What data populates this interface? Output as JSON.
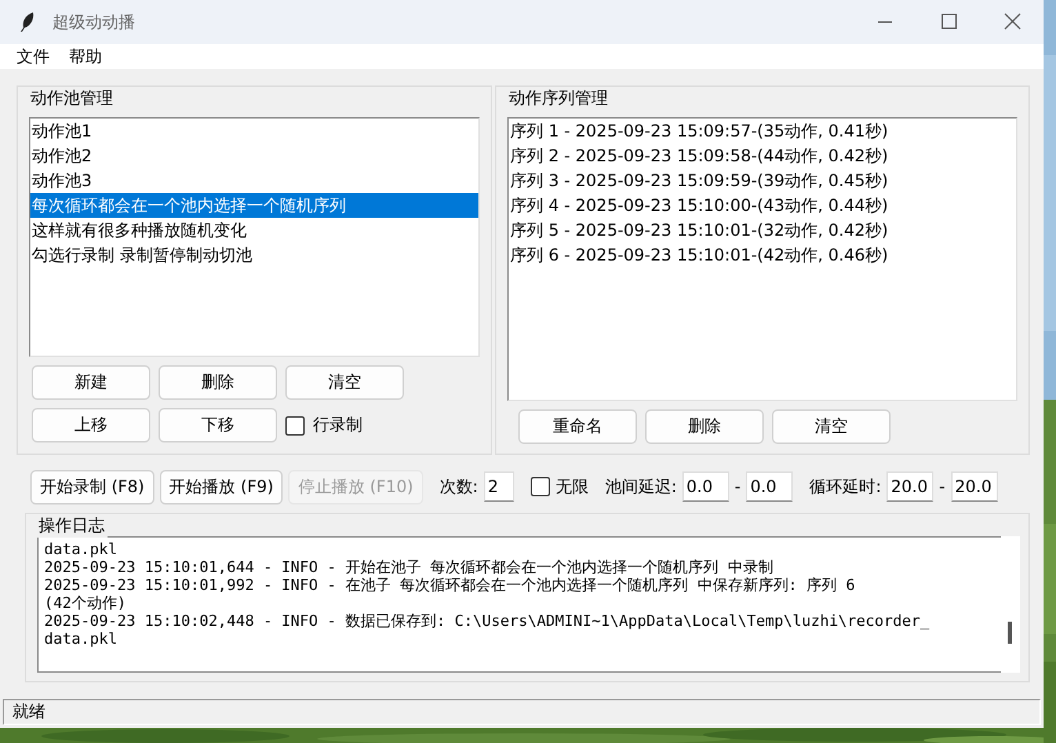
{
  "window": {
    "title": "超级动动播"
  },
  "menu": [
    "文件",
    "帮助"
  ],
  "pool_group": {
    "title": "动作池管理",
    "items": [
      {
        "label": "动作池1",
        "selected": false
      },
      {
        "label": "动作池2",
        "selected": false
      },
      {
        "label": "动作池3",
        "selected": false
      },
      {
        "label": "每次循环都会在一个池内选择一个随机序列",
        "selected": true
      },
      {
        "label": "这样就有很多种播放随机变化",
        "selected": false
      },
      {
        "label": "勾选行录制 录制暂停制动切池",
        "selected": false
      }
    ],
    "buttons_row_1": [
      "新建",
      "删除",
      "清空"
    ],
    "buttons_row_2": [
      "上移",
      "下移"
    ],
    "checkbox": {
      "label": "行录制",
      "checked": false
    }
  },
  "sequence_group": {
    "title": "动作序列管理",
    "items": [
      {
        "label": "序列 1 - 2025-09-23 15:09:57-(35动作, 0.41秒)",
        "selected": false
      },
      {
        "label": "序列 2 - 2025-09-23 15:09:58-(44动作, 0.42秒)",
        "selected": false
      },
      {
        "label": "序列 3 - 2025-09-23 15:09:59-(39动作, 0.45秒)",
        "selected": false
      },
      {
        "label": "序列 4 - 2025-09-23 15:10:00-(43动作, 0.44秒)",
        "selected": false
      },
      {
        "label": "序列 5 - 2025-09-23 15:10:01-(32动作, 0.42秒)",
        "selected": false
      },
      {
        "label": "序列 6 - 2025-09-23 15:10:01-(42动作, 0.46秒)",
        "selected": false
      }
    ],
    "buttons": [
      "重命名",
      "删除",
      "清空"
    ]
  },
  "controls": {
    "buttons": [
      {
        "label": "开始录制 (F8)",
        "disabled": false
      },
      {
        "label": "开始播放 (F9)",
        "disabled": false
      },
      {
        "label": "停止播放 (F10)",
        "disabled": true
      }
    ],
    "count": {
      "label": "次数:",
      "value": "2"
    },
    "infinite": {
      "label": "无限",
      "checked": false
    },
    "pool_delay": {
      "label": "池间延迟:",
      "min": "0.0",
      "separator": "-",
      "max": "0.0"
    },
    "loop_delay": {
      "label": "循环延时:",
      "min": "20.0",
      "separator": "-",
      "max": "20.0"
    }
  },
  "log": {
    "title": "操作日志",
    "lines": [
      "data.pkl",
      "2025-09-23 15:10:01,644 - INFO - 开始在池子 每次循环都会在一个池内选择一个随机序列 中录制",
      "2025-09-23 15:10:01,992 - INFO - 在池子 每次循环都会在一个池内选择一个随机序列 中保存新序列: 序列 6",
      "(42个动作)",
      "2025-09-23 15:10:02,448 - INFO - 数据已保存到: C:\\Users\\ADMINI~1\\AppData\\Local\\Temp\\luzhi\\recorder_",
      "data.pkl"
    ]
  },
  "status_bar": "就绪"
}
